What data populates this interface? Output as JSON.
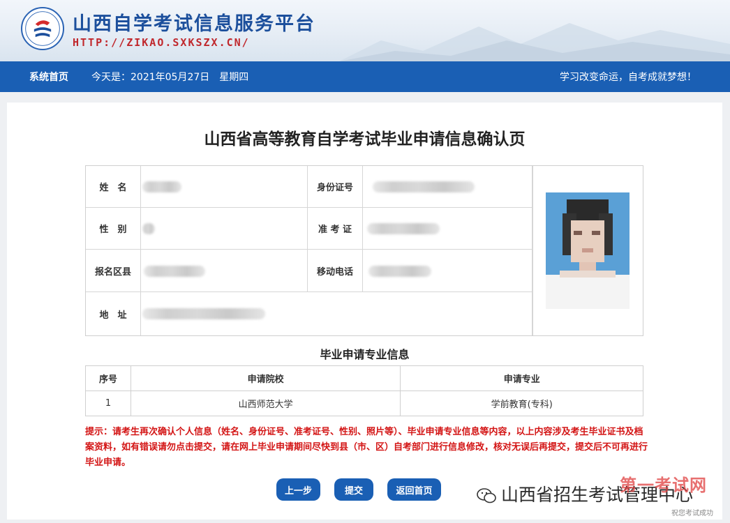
{
  "header": {
    "site_title": "山西自学考试信息服务平台",
    "site_url": "HTTP://ZIKAO.SXKSZX.CN/"
  },
  "nav": {
    "home": "系统首页",
    "date_label": "今天是：2021年05月27日",
    "weekday": "星期四",
    "slogan": "学习改变命运，自考成就梦想！"
  },
  "page": {
    "title": "山西省高等教育自学考试毕业申请信息确认页"
  },
  "info": {
    "name_label": "姓　名",
    "id_label": "身份证号",
    "gender_label": "性　别",
    "exam_no_label": "准 考 证",
    "district_label": "报名区县",
    "phone_label": "移动电话",
    "address_label": "地　址"
  },
  "major": {
    "section_title": "毕业申请专业信息",
    "headers": [
      "序号",
      "申请院校",
      "申请专业"
    ],
    "rows": [
      [
        "1",
        "山西师范大学",
        "学前教育(专科)"
      ]
    ]
  },
  "notice": "提示：请考生再次确认个人信息（姓名、身份证号、准考证号、性别、照片等）、毕业申请专业信息等内容，以上内容涉及考生毕业证书及档案资料，如有错误请勿点击提交，请在网上毕业申请期间尽快到县（市、区）自考部门进行信息修改，核对无误后再提交，提交后不可再进行毕业申请。",
  "buttons": {
    "prev": "上一步",
    "submit": "提交",
    "home": "返回首页"
  },
  "watermark": {
    "account": "山西省招生考试管理中心",
    "site": "第一考试网",
    "tagline": "祝您考试成功"
  },
  "colors": {
    "primary": "#1a5fb4",
    "notice_red": "#d31414",
    "url_red": "#c0282d"
  }
}
